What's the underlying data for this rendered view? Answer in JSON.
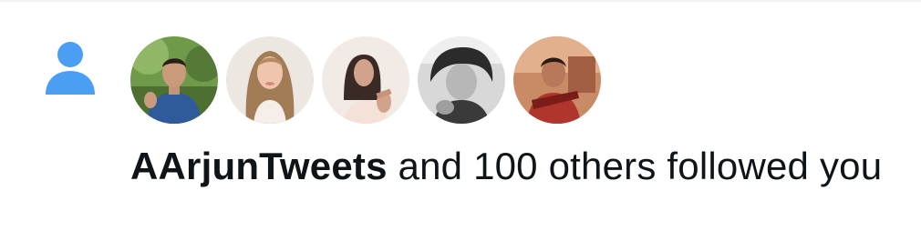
{
  "notification": {
    "type_icon": "person-icon",
    "type_icon_color": "#4a9ff5",
    "avatars": [
      {
        "name": "avatar-1"
      },
      {
        "name": "avatar-2"
      },
      {
        "name": "avatar-3"
      },
      {
        "name": "avatar-4"
      },
      {
        "name": "avatar-5"
      }
    ],
    "username": "AArjunTweets",
    "message_rest": " and 100 others followed you"
  }
}
